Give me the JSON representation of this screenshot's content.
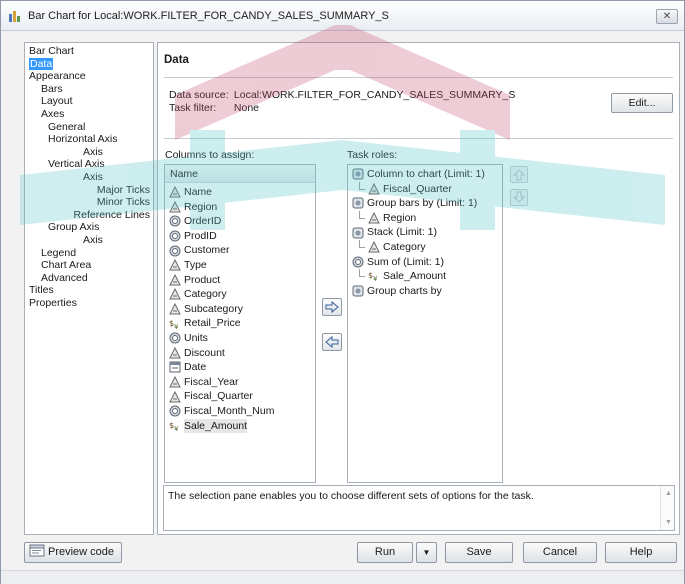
{
  "window": {
    "title": "Bar Chart for Local:WORK.FILTER_FOR_CANDY_SALES_SUMMARY_S",
    "close_glyph": "✕"
  },
  "nav": {
    "items": [
      {
        "label": "Bar Chart",
        "level": 0,
        "selected": false
      },
      {
        "label": "Data",
        "level": 0,
        "selected": true
      },
      {
        "label": "Appearance",
        "level": 0,
        "selected": false
      },
      {
        "label": "Bars",
        "level": 1,
        "selected": false
      },
      {
        "label": "Layout",
        "level": 1,
        "selected": false
      },
      {
        "label": "Axes",
        "level": 1,
        "selected": false
      },
      {
        "label": "General",
        "level": 2,
        "selected": false
      },
      {
        "label": "Horizontal Axis",
        "level": 2,
        "selected": false
      },
      {
        "label": "Axis",
        "level": 3,
        "selected": false
      },
      {
        "label": "Vertical Axis",
        "level": 2,
        "selected": false
      },
      {
        "label": "Axis",
        "level": 3,
        "selected": false
      },
      {
        "label": "Major Ticks",
        "level": 3,
        "selected": false
      },
      {
        "label": "Minor Ticks",
        "level": 3,
        "selected": false
      },
      {
        "label": "Reference Lines",
        "level": 3,
        "selected": false
      },
      {
        "label": "Group Axis",
        "level": 2,
        "selected": false
      },
      {
        "label": "Axis",
        "level": 3,
        "selected": false
      },
      {
        "label": "Legend",
        "level": 1,
        "selected": false
      },
      {
        "label": "Chart Area",
        "level": 1,
        "selected": false
      },
      {
        "label": "Advanced",
        "level": 1,
        "selected": false
      },
      {
        "label": "Titles",
        "level": 0,
        "selected": false
      },
      {
        "label": "Properties",
        "level": 0,
        "selected": false
      }
    ]
  },
  "panel": {
    "header": "Data",
    "data_source_label": "Data source:",
    "data_source_value": "Local:WORK.FILTER_FOR_CANDY_SALES_SUMMARY_S",
    "task_filter_label": "Task filter:",
    "task_filter_value": "None",
    "edit_label": "Edit...",
    "columns_label": "Columns to assign:",
    "columns_header": "Name",
    "columns": [
      {
        "name": "Name",
        "icon": "character-icon",
        "selected": false
      },
      {
        "name": "Region",
        "icon": "character-icon",
        "selected": false
      },
      {
        "name": "OrderID",
        "icon": "numeric-icon",
        "selected": false
      },
      {
        "name": "ProdID",
        "icon": "numeric-icon",
        "selected": false
      },
      {
        "name": "Customer",
        "icon": "numeric-icon",
        "selected": false
      },
      {
        "name": "Type",
        "icon": "character-icon",
        "selected": false
      },
      {
        "name": "Product",
        "icon": "character-icon",
        "selected": false
      },
      {
        "name": "Category",
        "icon": "character-icon",
        "selected": false
      },
      {
        "name": "Subcategory",
        "icon": "character-icon",
        "selected": false
      },
      {
        "name": "Retail_Price",
        "icon": "currency-icon",
        "selected": false
      },
      {
        "name": "Units",
        "icon": "numeric-icon",
        "selected": false
      },
      {
        "name": "Discount",
        "icon": "character-icon",
        "selected": false
      },
      {
        "name": "Date",
        "icon": "date-icon",
        "selected": false
      },
      {
        "name": "Fiscal_Year",
        "icon": "character-icon",
        "selected": false
      },
      {
        "name": "Fiscal_Quarter",
        "icon": "character-icon",
        "selected": false
      },
      {
        "name": "Fiscal_Month_Num",
        "icon": "numeric-icon",
        "selected": false
      },
      {
        "name": "Sale_Amount",
        "icon": "currency-icon",
        "selected": true
      }
    ],
    "roles_label": "Task roles:",
    "roles": [
      {
        "label": "Column to chart  (Limit: 1)",
        "level": 0,
        "icon": "role-icon"
      },
      {
        "label": "Fiscal_Quarter",
        "level": 1,
        "icon": "character-icon"
      },
      {
        "label": "Group bars by  (Limit: 1)",
        "level": 0,
        "icon": "role-icon"
      },
      {
        "label": "Region",
        "level": 1,
        "icon": "character-icon"
      },
      {
        "label": "Stack  (Limit: 1)",
        "level": 0,
        "icon": "role-icon"
      },
      {
        "label": "Category",
        "level": 1,
        "icon": "character-icon"
      },
      {
        "label": "Sum of  (Limit: 1)",
        "level": 0,
        "icon": "numeric-icon"
      },
      {
        "label": "Sale_Amount",
        "level": 1,
        "icon": "currency-icon"
      },
      {
        "label": "Group charts by",
        "level": 0,
        "icon": "role-icon"
      }
    ],
    "help_text": "The selection pane enables you to choose different sets of options for the task."
  },
  "buttons": {
    "preview_code": "Preview code",
    "run": "Run",
    "save": "Save",
    "cancel": "Cancel",
    "help": "Help"
  },
  "colors": {
    "selection": "#3399ff",
    "watermark": "#4fc3c8",
    "logo_accent": "#c44a6a"
  }
}
